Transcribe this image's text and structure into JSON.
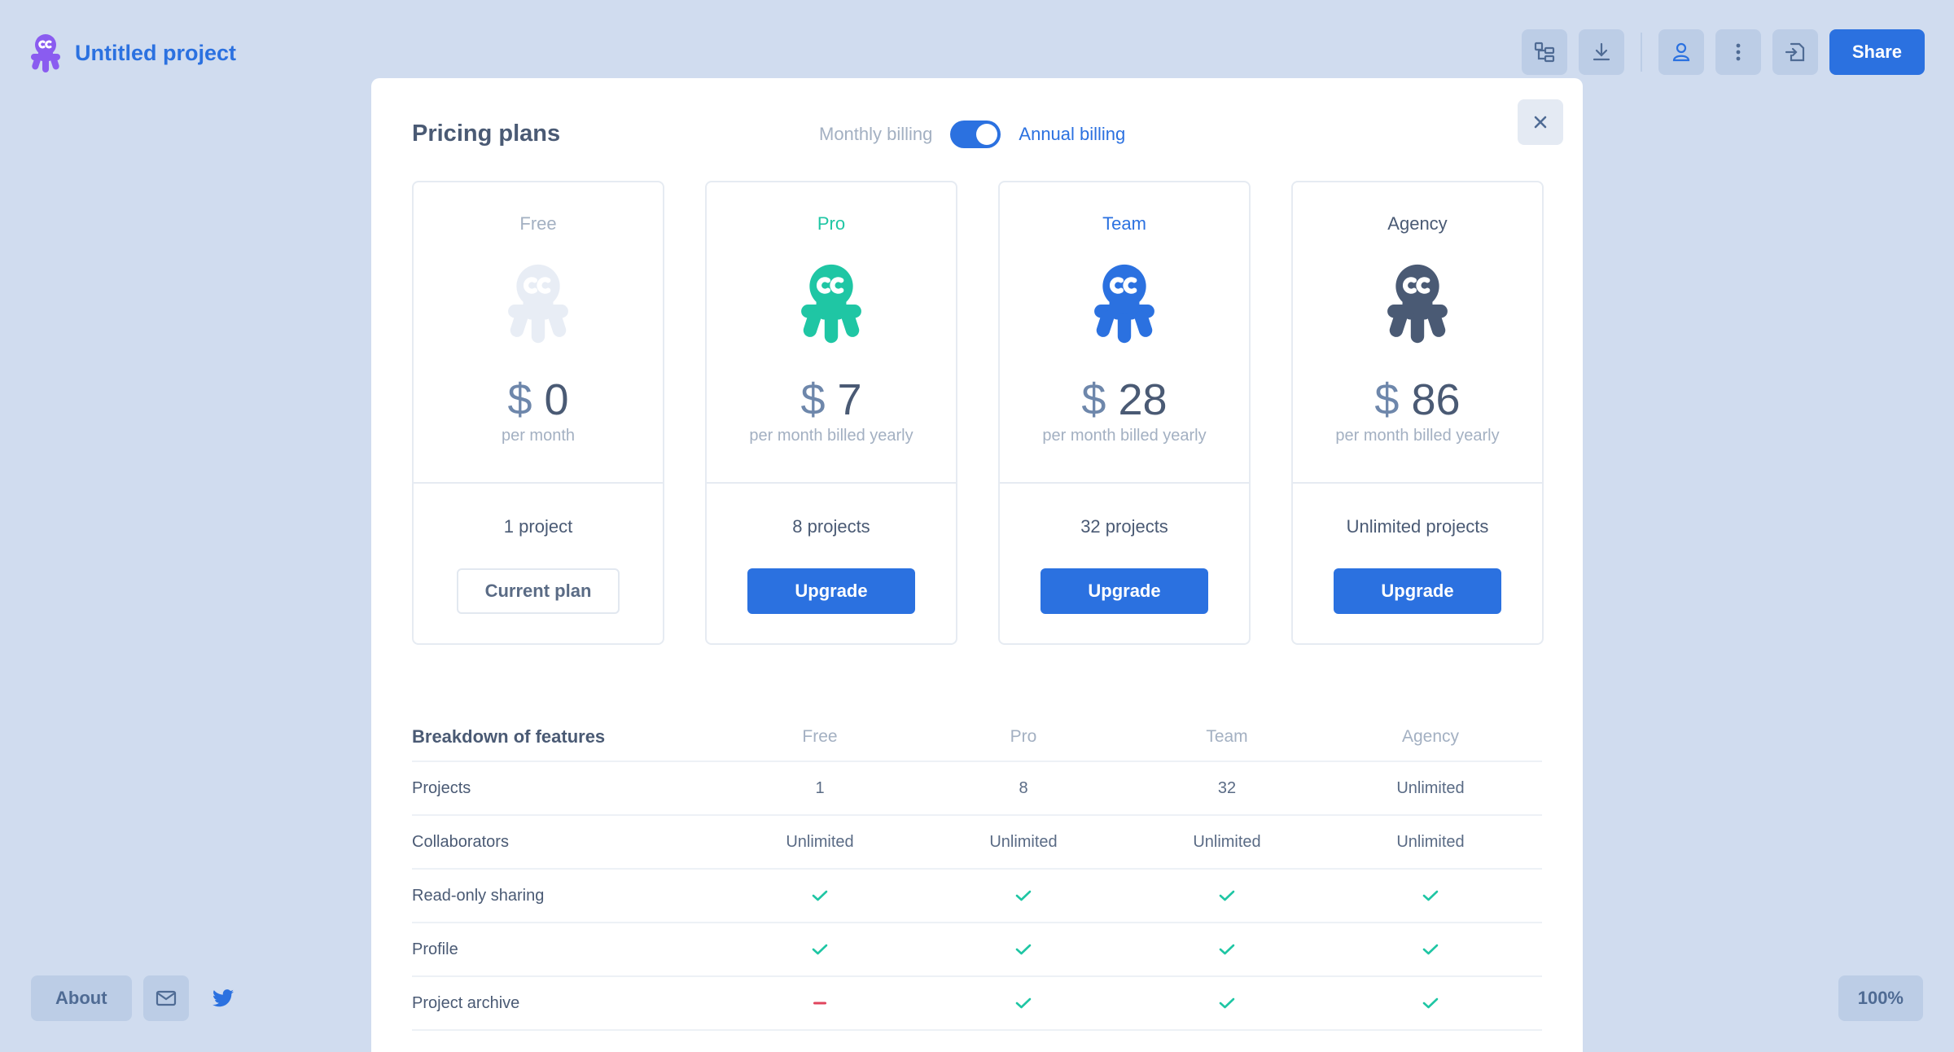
{
  "app": {
    "title": "Untitled project"
  },
  "toolbar": {
    "share_label": "Share"
  },
  "footer": {
    "about_label": "About",
    "zoom": "100%"
  },
  "modal": {
    "title": "Pricing plans",
    "billing_monthly": "Monthly billing",
    "billing_annual": "Annual billing",
    "annual_selected": true
  },
  "plans": [
    {
      "name": "Free",
      "color": "#a3b0c2",
      "icon_color": "#e8edf5",
      "currency": "$",
      "price": "0",
      "period": "per month",
      "projects": "1 project",
      "button": "Current plan",
      "current": true
    },
    {
      "name": "Pro",
      "color": "#1fc6a4",
      "icon_color": "#1fc6a4",
      "currency": "$",
      "price": "7",
      "period": "per month billed yearly",
      "projects": "8 projects",
      "button": "Upgrade",
      "current": false
    },
    {
      "name": "Team",
      "color": "#2b71e0",
      "icon_color": "#2b71e0",
      "currency": "$",
      "price": "28",
      "period": "per month billed yearly",
      "projects": "32 projects",
      "button": "Upgrade",
      "current": false
    },
    {
      "name": "Agency",
      "color": "#4a5a74",
      "icon_color": "#4a5a74",
      "currency": "$",
      "price": "86",
      "period": "per month billed yearly",
      "projects": "Unlimited projects",
      "button": "Upgrade",
      "current": false
    }
  ],
  "features": {
    "title": "Breakdown of features",
    "columns": [
      "Free",
      "Pro",
      "Team",
      "Agency"
    ],
    "rows": [
      {
        "label": "Projects",
        "values": [
          "1",
          "8",
          "32",
          "Unlimited"
        ]
      },
      {
        "label": "Collaborators",
        "values": [
          "Unlimited",
          "Unlimited",
          "Unlimited",
          "Unlimited"
        ]
      },
      {
        "label": "Read-only sharing",
        "values": [
          "check",
          "check",
          "check",
          "check"
        ]
      },
      {
        "label": "Profile",
        "values": [
          "check",
          "check",
          "check",
          "check"
        ]
      },
      {
        "label": "Project archive",
        "values": [
          "dash",
          "check",
          "check",
          "check"
        ]
      }
    ]
  },
  "colors": {
    "accent": "#2b71e0",
    "check": "#1fc6a4",
    "dash": "#e0455d",
    "brand_icon": "#8a5cf0"
  }
}
